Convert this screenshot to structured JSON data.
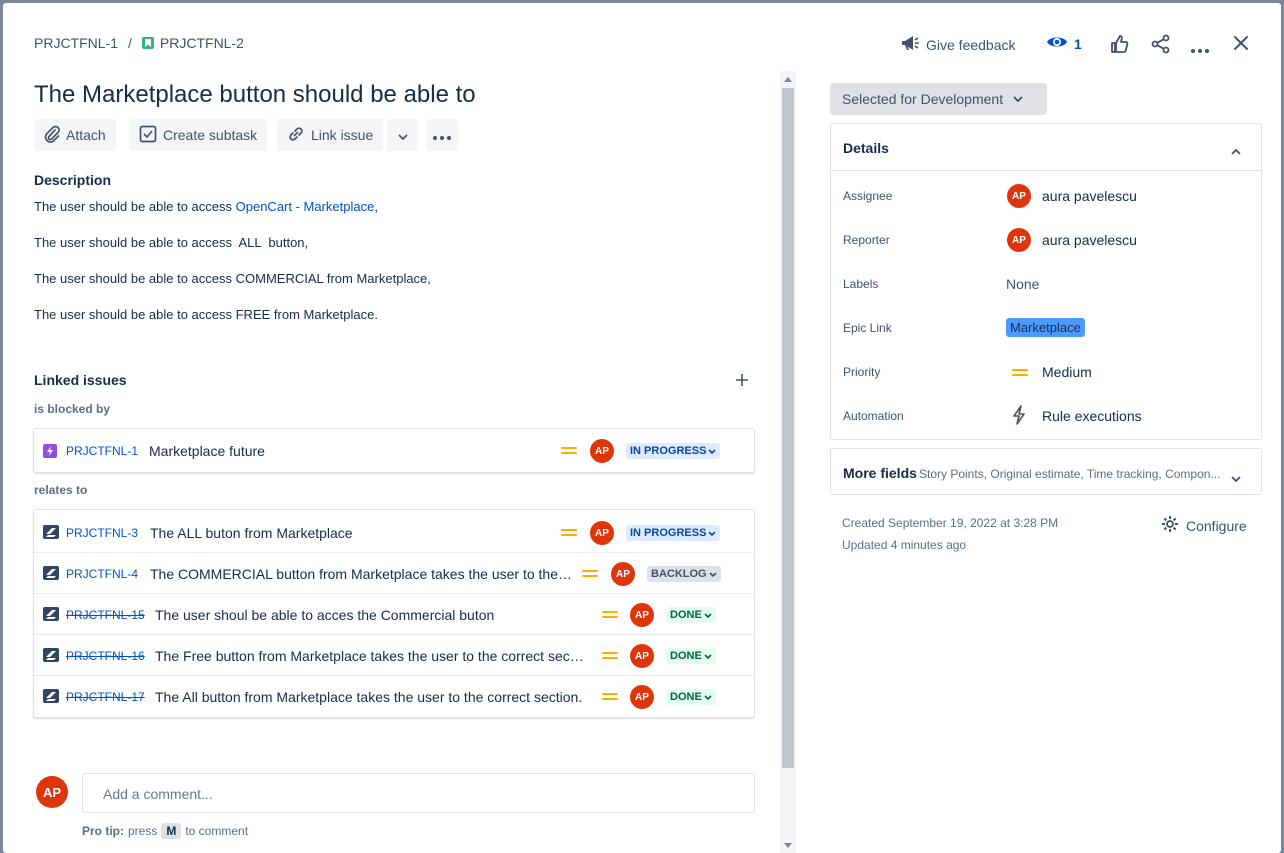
{
  "breadcrumb": {
    "parent": "PRJCTFNL-1",
    "separator": "/",
    "current": "PRJCTFNL-2"
  },
  "topbar": {
    "feedback": "Give feedback",
    "watchers": "1"
  },
  "issue": {
    "title": "The Marketplace button should be able to"
  },
  "toolbar": {
    "attach": "Attach",
    "create_subtask": "Create subtask",
    "link_issue": "Link issue"
  },
  "description": {
    "heading": "Description",
    "line1_prefix": "The user should be able to access ",
    "line1_link": "OpenCart - Marketplace",
    "line1_suffix": ",",
    "line2": "The user should be able to access  ALL  button,",
    "line3": "The user should be able to access COMMERCIAL from Marketplace,",
    "line4": "The user should be able to access FREE from Marketplace."
  },
  "linked": {
    "heading": "Linked issues",
    "blocked_label": "is blocked by",
    "relates_label": "relates to",
    "blocked": [
      {
        "key": "PRJCTFNL-1",
        "summary": "Marketplace future",
        "avatar": "AP",
        "status": "IN PROGRESS"
      }
    ],
    "relates": [
      {
        "key": "PRJCTFNL-3",
        "summary": "The ALL buton from Marketplace",
        "avatar": "AP",
        "status": "IN PROGRESS"
      },
      {
        "key": "PRJCTFNL-4",
        "summary": "The COMMERCIAL button from Marketplace takes the user to the ...",
        "avatar": "AP",
        "status": "BACKLOG"
      },
      {
        "key": "PRJCTFNL-15",
        "summary": "The user shoul be able to acces the Commercial buton",
        "avatar": "AP",
        "status": "DONE"
      },
      {
        "key": "PRJCTFNL-16",
        "summary": "The Free button from Marketplace takes the user to the correct secti...",
        "avatar": "AP",
        "status": "DONE"
      },
      {
        "key": "PRJCTFNL-17",
        "summary": "The All button from Marketplace takes the user to the correct section.",
        "avatar": "AP",
        "status": "DONE"
      }
    ]
  },
  "comment": {
    "avatar": "AP",
    "placeholder": "Add a comment...",
    "protip_prefix": "Pro tip:",
    "protip_press": "press",
    "protip_key": "M",
    "protip_suffix": "to comment"
  },
  "sidebar": {
    "status": "Selected for Development",
    "details_heading": "Details",
    "fields": {
      "assignee_label": "Assignee",
      "assignee": "aura pavelescu",
      "assignee_avatar": "AP",
      "reporter_label": "Reporter",
      "reporter": "aura pavelescu",
      "reporter_avatar": "AP",
      "labels_label": "Labels",
      "labels": "None",
      "epic_label": "Epic Link",
      "epic": "Marketplace",
      "priority_label": "Priority",
      "priority": "Medium",
      "automation_label": "Automation",
      "automation": "Rule executions"
    },
    "more_fields": "More fields",
    "more_fields_hint": "Story Points, Original estimate, Time tracking, Compon...",
    "created": "Created September 19, 2022 at 3:28 PM",
    "updated": "Updated 4 minutes ago",
    "configure": "Configure"
  },
  "colors": {
    "link": "#0052cc",
    "priority": "#ffab00",
    "avatar": "#de350b",
    "epic": "#4c9aff"
  }
}
